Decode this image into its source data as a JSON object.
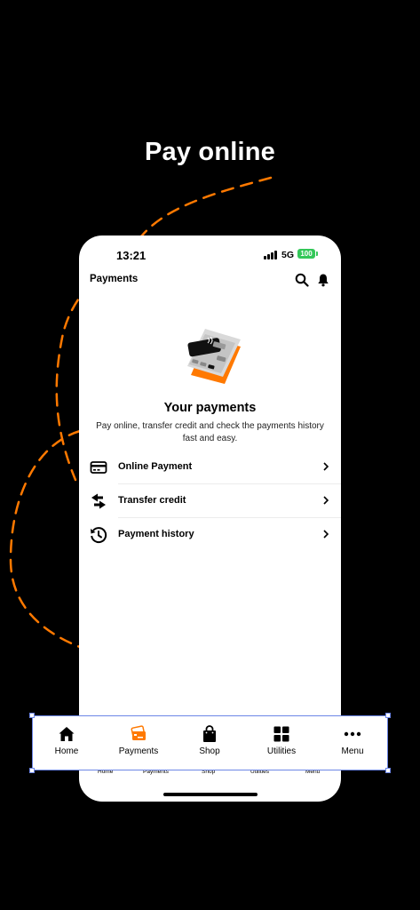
{
  "headline": "Pay online",
  "status_bar": {
    "time": "13:21",
    "network": "5G",
    "battery": "100"
  },
  "app_bar": {
    "title": "Payments"
  },
  "hero": {
    "title": "Your payments",
    "description": "Pay online, transfer credit and check the payments history fast and easy."
  },
  "menu": [
    {
      "label": "Online Payment",
      "icon": "credit-card-icon"
    },
    {
      "label": "Transfer credit",
      "icon": "transfer-arrows-icon"
    },
    {
      "label": "Payment history",
      "icon": "history-clock-icon"
    }
  ],
  "mini_nav": [
    "Home",
    "Payments",
    "Shop",
    "Utilities",
    "Menu"
  ],
  "nav_bar": {
    "active": "Payments",
    "items": [
      {
        "label": "Home",
        "icon": "home-icon"
      },
      {
        "label": "Payments",
        "icon": "payment-cards-icon"
      },
      {
        "label": "Shop",
        "icon": "shopping-bag-icon"
      },
      {
        "label": "Utilities",
        "icon": "grid-icon"
      },
      {
        "label": "Menu",
        "icon": "more-dots-icon"
      }
    ]
  },
  "colors": {
    "accent": "#ff7900",
    "selection": "#6d86e6",
    "battery": "#34c759"
  }
}
